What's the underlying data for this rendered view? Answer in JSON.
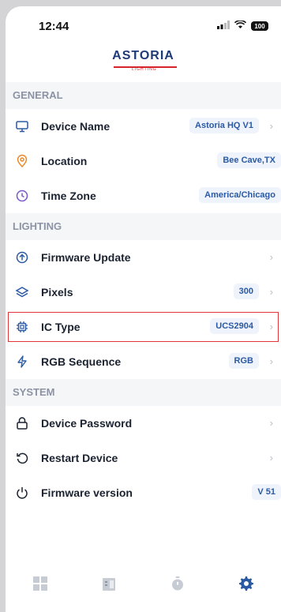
{
  "status_bar": {
    "time": "12:44",
    "battery": "100"
  },
  "brand": {
    "name": "ASTORIA",
    "sub": "LIGHTING"
  },
  "sections": {
    "general": "GENERAL",
    "lighting": "LIGHTING",
    "system": "SYSTEM"
  },
  "rows": {
    "device_name": {
      "label": "Device Name",
      "value": "Astoria HQ V1",
      "icon": "monitor-icon"
    },
    "location": {
      "label": "Location",
      "value": "Bee Cave,TX",
      "icon": "location-pin-icon"
    },
    "time_zone": {
      "label": "Time Zone",
      "value": "America/Chicago",
      "icon": "clock-icon"
    },
    "firmware_update": {
      "label": "Firmware Update",
      "icon": "upload-arrow-icon"
    },
    "pixels": {
      "label": "Pixels",
      "value": "300",
      "icon": "layers-icon"
    },
    "ic_type": {
      "label": "IC Type",
      "value": "UCS2904",
      "icon": "chip-icon"
    },
    "rgb_sequence": {
      "label": "RGB Sequence",
      "value": "RGB",
      "icon": "lightning-icon"
    },
    "device_password": {
      "label": "Device Password",
      "icon": "lock-icon"
    },
    "restart_device": {
      "label": "Restart Device",
      "icon": "restart-icon"
    },
    "firmware_version": {
      "label": "Firmware version",
      "value": "V 51",
      "icon": "power-icon"
    }
  },
  "tabs": [
    "dashboard-tab",
    "building-tab",
    "timer-tab",
    "settings-tab"
  ],
  "colors": {
    "accent": "#2b5aa3",
    "highlight_border": "#e0363a",
    "location_icon": "#e8892a",
    "time_zone_icon": "#7a56c6",
    "settings_tab_active": "#2b5aa3"
  }
}
